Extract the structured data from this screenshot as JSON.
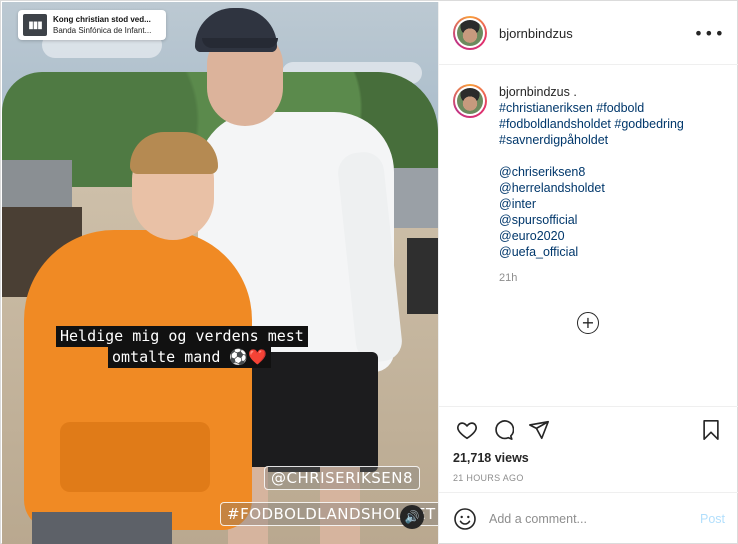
{
  "post": {
    "username": "bjornbindzus",
    "caption_username": "bjornbindzus",
    "caption_dot": ".",
    "hashtags": [
      "#christianeriksen #fodbold",
      "#fodboldlandsholdet #godbedring",
      "#savnerdigpåholdet"
    ],
    "mentions": [
      "@chriseriksen8",
      "@herrelandsholdet",
      "@inter",
      "@spursofficial",
      "@euro2020",
      "@uefa_official"
    ],
    "relative_time": "21h",
    "views": "21,718 views",
    "posted_time": "21 HOURS AGO"
  },
  "media": {
    "music_title": "Kong christian stod ved...",
    "music_artist": "Banda Sinfónica de Infant...",
    "caption_line1": "Heldige mig og verdens mest",
    "caption_line2": "omtalte mand ⚽❤️",
    "tag1": "@CHRISERIKSEN8",
    "tag2": "#FODBOLDLANDSHOLDET"
  },
  "comment_box": {
    "placeholder": "Add a comment...",
    "post_label": "Post"
  },
  "icons": {
    "more": "more-options-icon",
    "heart": "heart-icon",
    "comment": "comment-icon",
    "share": "share-icon",
    "bookmark": "bookmark-icon",
    "emoji": "emoji-icon",
    "sound": "sound-icon",
    "add": "plus-circle-icon"
  },
  "colors": {
    "link": "#00376b",
    "muted": "#8e8e8e",
    "post_disabled": "#b2dffc"
  }
}
